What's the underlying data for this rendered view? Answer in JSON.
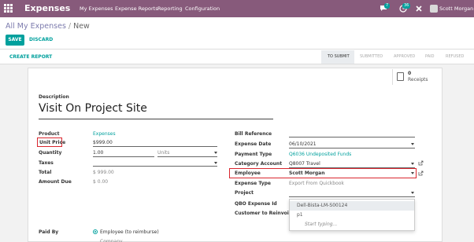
{
  "nav": {
    "app_title": "Expenses",
    "menu": [
      "My Expenses",
      "Expense Reports",
      "Reporting",
      "Configuration"
    ],
    "chat_badge": "7",
    "activity_badge": "36",
    "user_name": "Scott Morgan"
  },
  "breadcrumb": {
    "parent": "All My Expenses",
    "separator": "/",
    "current": "New"
  },
  "actions": {
    "save": "SAVE",
    "discard": "DISCARD"
  },
  "statusbar": {
    "create_report": "CREATE REPORT",
    "stages": [
      "TO SUBMIT",
      "SUBMITTED",
      "APPROVED",
      "PAID",
      "REFUSED"
    ],
    "active_stage": "TO SUBMIT"
  },
  "smart_button": {
    "count": "0",
    "label": "Receipts"
  },
  "form": {
    "description_label": "Description",
    "description_value": "Visit On Project Site",
    "product_label": "Product",
    "product_value": "Expenses",
    "unit_price_label": "Unit Price",
    "unit_price_value": "$999.00",
    "quantity_label": "Quantity",
    "quantity_value": "1.00",
    "units_placeholder": "Units",
    "taxes_label": "Taxes",
    "total_label": "Total",
    "total_value": "$ 999.00",
    "amount_due_label": "Amount Due",
    "amount_due_value": "$ 0.00",
    "bill_reference_label": "Bill Reference",
    "expense_date_label": "Expense Date",
    "expense_date_value": "06/10/2021",
    "payment_type_label": "Payment Type",
    "payment_type_value": "Q6036 Undeposited Funds",
    "category_account_label": "Category Account",
    "category_account_value": "Q8007 Travel",
    "employee_label": "Employee",
    "employee_value": "Scott Morgan",
    "expense_type_label": "Expense Type",
    "expense_type_value": "Export From Quickbook",
    "project_label": "Project",
    "qbo_expense_id_label": "QBO Expense Id",
    "customer_reinvoice_label": "Customer to Reinvoice",
    "paid_by_label": "Paid By",
    "paid_by_option": "Employee (to reimburse)",
    "paid_by_option_2": "Company"
  },
  "project_dropdown": {
    "items": [
      "Dell-Bista-LM-S00124",
      "p1",
      "Start typing..."
    ]
  },
  "colors": {
    "navbar": "#875a7b",
    "primary": "#00a09d",
    "highlight_box": "#d9262e"
  }
}
